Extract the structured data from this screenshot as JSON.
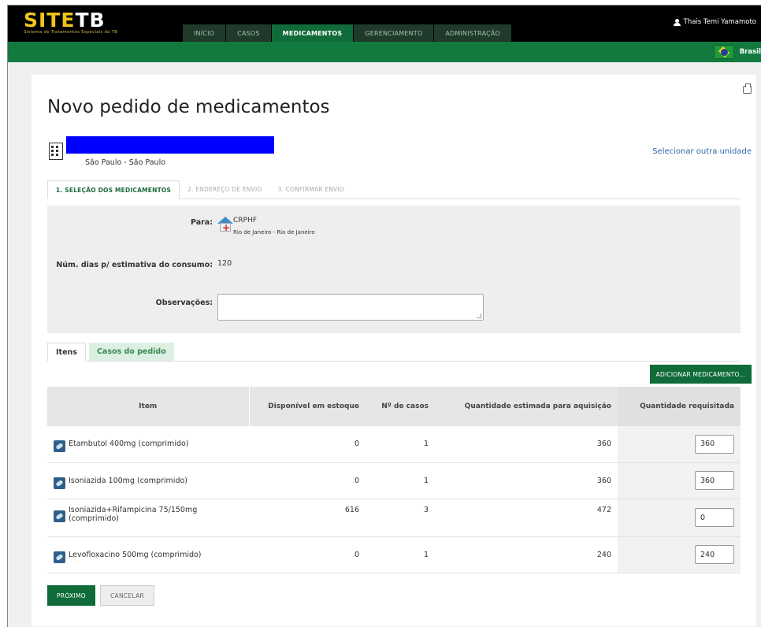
{
  "header": {
    "logo": "SITETB",
    "logo_subtitle": "Sistema de Tratamentos Especiais da TB",
    "nav": [
      "INÍCIO",
      "CASOS",
      "MEDICAMENTOS",
      "GERENCIAMENTO",
      "ADMINISTRAÇÃO"
    ],
    "active_nav": "MEDICAMENTOS",
    "user": "Thais Temi Yamamoto",
    "country": "Brasil"
  },
  "page": {
    "title": "Novo pedido de medicamentos",
    "unit_location": "São Paulo - São Paulo",
    "other_unit_link": "Selecionar outra unidade"
  },
  "steps": [
    "1. SELEÇÃO DOS MEDICAMENTOS",
    "2. ENDEREÇO DE ENVIO",
    "3. CONFIRMAR ENVIO"
  ],
  "form": {
    "to_label": "Para:",
    "destination": "CRPHF",
    "destination_region": "Rio de Janeiro - Rio de Janeiro",
    "days_label": "Núm. dias p/ estimativa do consumo:",
    "days_value": "120",
    "notes_label": "Observações:",
    "notes_value": ""
  },
  "subtabs": [
    "Itens",
    "Casos do pedido"
  ],
  "add_button": "ADICIONAR MEDICAMENTO...",
  "table": {
    "headers": [
      "Item",
      "Disponível em estoque",
      "Nº de casos",
      "Quantidade estimada para aquisição",
      "Quantidade requisitada"
    ],
    "rows": [
      {
        "item": "Etambutol 400mg (comprimido)",
        "stock": "0",
        "cases": "1",
        "estimated": "360",
        "requested": "360"
      },
      {
        "item": "Isoniazida 100mg (comprimido)",
        "stock": "0",
        "cases": "1",
        "estimated": "360",
        "requested": "360"
      },
      {
        "item": "Isoniazida+Rifampicina 75/150mg (comprimido)",
        "stock": "616",
        "cases": "3",
        "estimated": "472",
        "requested": "0"
      },
      {
        "item": "Levofloxacino 500mg (comprimido)",
        "stock": "0",
        "cases": "1",
        "estimated": "240",
        "requested": "240"
      }
    ]
  },
  "buttons": {
    "next": "PRÓXIMO",
    "cancel": "CANCELAR"
  },
  "colors": {
    "brand_green": "#0f6b38",
    "header_bg": "#000000",
    "logo_accent": "#f0c419",
    "redaction": "#0000ff"
  }
}
